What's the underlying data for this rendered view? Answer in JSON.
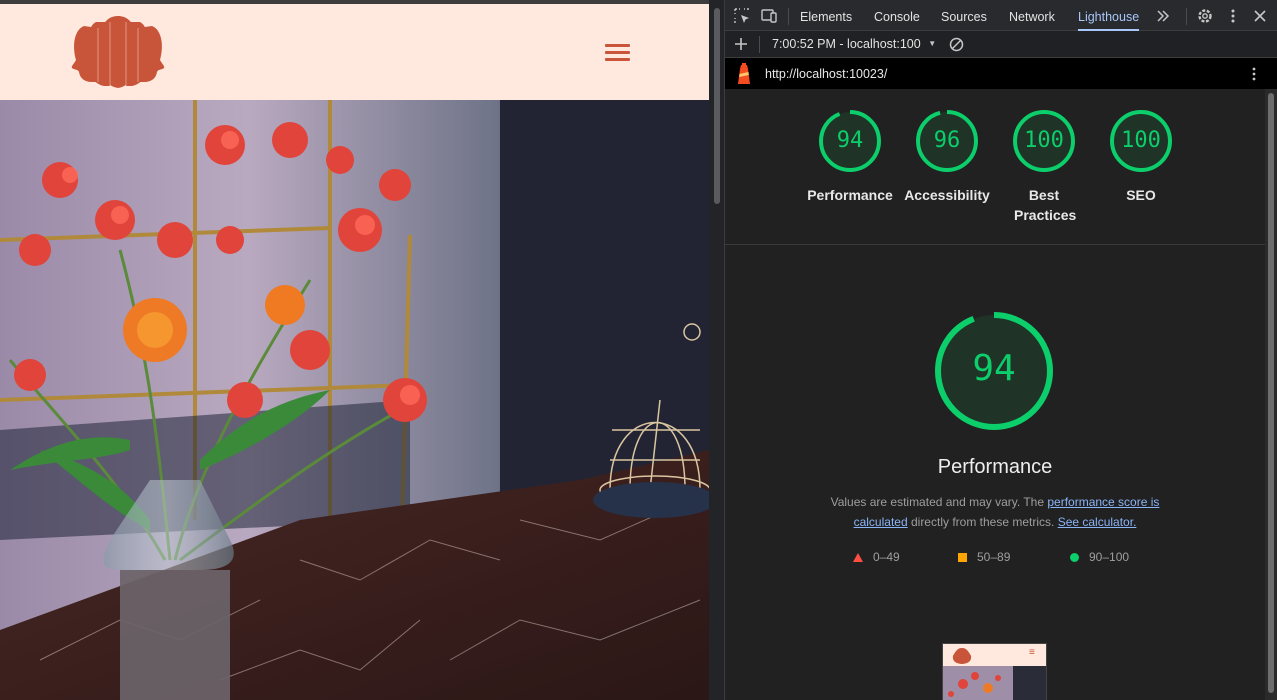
{
  "devtools": {
    "tabs": [
      {
        "label": "Elements"
      },
      {
        "label": "Console"
      },
      {
        "label": "Sources"
      },
      {
        "label": "Network"
      },
      {
        "label": "Lighthouse"
      }
    ],
    "more_tabs_icon": "chevrons-right-icon",
    "report_selector": "7:00:52 PM - localhost:100",
    "url": "http://localhost:10023/"
  },
  "lighthouse": {
    "categories": [
      {
        "label": "Performance",
        "score": 94
      },
      {
        "label": "Accessibility",
        "score": 96
      },
      {
        "label": "Best Practices",
        "score": 100
      },
      {
        "label": "SEO",
        "score": 100
      }
    ],
    "main": {
      "score": 94,
      "title": "Performance",
      "desc_prefix": "Values are estimated and may vary. The ",
      "desc_link1": "performance score is calculated",
      "desc_mid": " directly from these metrics. ",
      "desc_link2": "See calculator."
    },
    "legend": [
      {
        "range": "0–49",
        "color": "#ff4e42",
        "shape": "triangle"
      },
      {
        "range": "50–89",
        "color": "#ffa400",
        "shape": "square"
      },
      {
        "range": "90–100",
        "color": "#0cce6b",
        "shape": "circle"
      }
    ]
  },
  "colors": {
    "pass": "#0cce6b",
    "site_header_bg": "#ffe8dd",
    "brand": "#c8553a",
    "devtools_accent": "#a8c7fa"
  }
}
